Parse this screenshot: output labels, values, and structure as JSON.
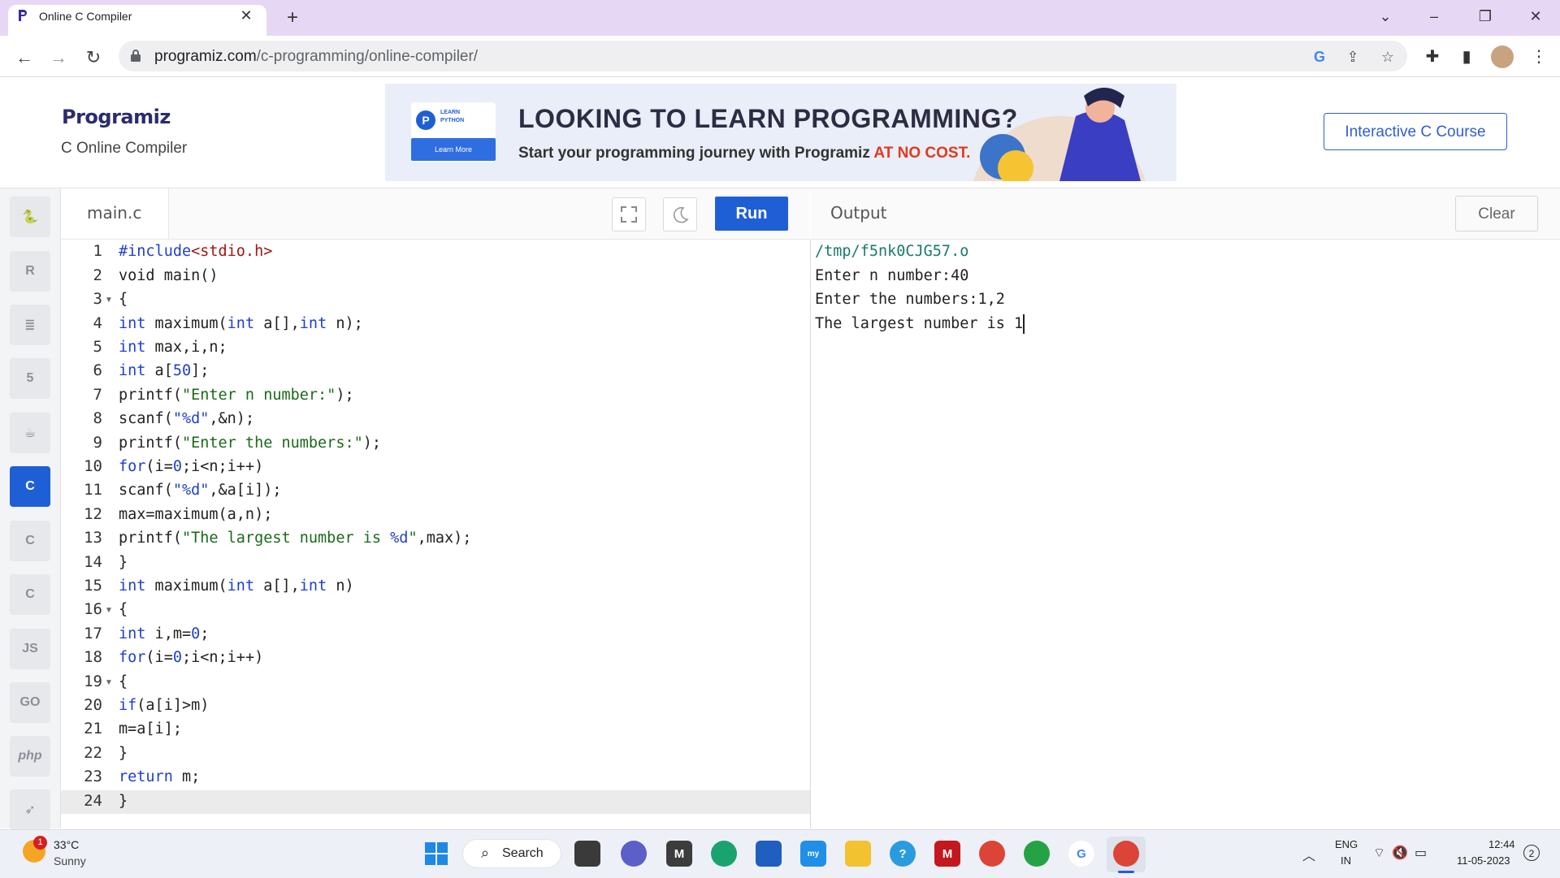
{
  "browser": {
    "tab_title": "Online C Compiler",
    "tab_close": "✕",
    "new_tab": "+",
    "url_domain": "programiz.com",
    "url_path": "/c-programming/online-compiler/",
    "controls": {
      "minimize": "–",
      "restore": "❐",
      "close": "✕",
      "tab_search": "⌄"
    }
  },
  "site": {
    "logo": "Programiz",
    "subtitle": "C Online Compiler",
    "banner": {
      "badge_line1": "LEARN",
      "badge_line2": "PYTHON",
      "learn_more": "Learn More",
      "title": "LOOKING TO LEARN PROGRAMMING?",
      "subtitle_prefix": "Start your programming journey with Programiz ",
      "subtitle_highlight": "AT NO COST."
    },
    "course_button": "Interactive C Course"
  },
  "sidebar": {
    "languages": [
      {
        "name": "python",
        "label": "🐍"
      },
      {
        "name": "r",
        "label": "R"
      },
      {
        "name": "sql",
        "label": "≣"
      },
      {
        "name": "html",
        "label": "5"
      },
      {
        "name": "java",
        "label": "☕"
      },
      {
        "name": "c",
        "label": "C",
        "active": true
      },
      {
        "name": "cpp",
        "label": "C"
      },
      {
        "name": "csharp",
        "label": "C"
      },
      {
        "name": "js",
        "label": "JS"
      },
      {
        "name": "go",
        "label": "GO"
      },
      {
        "name": "php",
        "label": "php"
      },
      {
        "name": "swift",
        "label": "➶"
      }
    ]
  },
  "editor": {
    "file_name": "main.c",
    "run_label": "Run",
    "lines": [
      "1",
      "2",
      "3",
      "4",
      "5",
      "6",
      "7",
      "8",
      "9",
      "10",
      "11",
      "12",
      "13",
      "14",
      "15",
      "16",
      "17",
      "18",
      "19",
      "20",
      "21",
      "22",
      "23",
      "24"
    ],
    "code": {
      "l1a": "#include",
      "l1b": "<stdio.h>",
      "l2": "void main()",
      "l3": "{",
      "l4a": "int",
      "l4b": " maximum(",
      "l4c": "int",
      "l4d": " a[],",
      "l4e": "int",
      "l4f": " n);",
      "l5a": "int",
      "l5b": " max,i,n;",
      "l6a": "int",
      "l6b": " a[",
      "l6c": "50",
      "l6d": "];",
      "l7a": "printf(",
      "l7b": "\"Enter n number:\"",
      "l7c": ");",
      "l8a": "scanf(",
      "l8b": "\"%d\"",
      "l8c": ",&n);",
      "l9a": "printf(",
      "l9b": "\"Enter the numbers:\"",
      "l9c": ");",
      "l10a": "for",
      "l10b": "(i=",
      "l10c": "0",
      "l10d": ";i<n;i++)",
      "l11a": "scanf(",
      "l11b": "\"%d\"",
      "l11c": ",&a[i]);",
      "l12": "max=maximum(a,n);",
      "l13a": "printf(",
      "l13b": "\"The largest number is ",
      "l13c": "%d",
      "l13d": "\"",
      "l13e": ",max);",
      "l14": "}",
      "l15a": "int",
      "l15b": " maximum(",
      "l15c": "int",
      "l15d": " a[],",
      "l15e": "int",
      "l15f": " n)",
      "l16": "{",
      "l17a": "int",
      "l17b": " i,m=",
      "l17c": "0",
      "l17d": ";",
      "l18a": "for",
      "l18b": "(i=",
      "l18c": "0",
      "l18d": ";i<n;i++)",
      "l19": "{",
      "l20a": "if",
      "l20b": "(a[i]>m)",
      "l21": "m=a[i];",
      "l22": "}",
      "l23a": "return",
      "l23b": " m;",
      "l24": "}"
    }
  },
  "output": {
    "label": "Output",
    "clear_label": "Clear",
    "lines": [
      "/tmp/f5nk0CJG57.o",
      "Enter n number:40",
      "Enter the numbers:1,2",
      "The largest number is 1"
    ]
  },
  "taskbar": {
    "weather_temp": "33°C",
    "weather_desc": "Sunny",
    "weather_badge": "1",
    "search_label": "Search",
    "lang_top": "ENG",
    "lang_bottom": "IN",
    "time": "12:44",
    "date": "11-05-2023",
    "notifications": "2"
  }
}
